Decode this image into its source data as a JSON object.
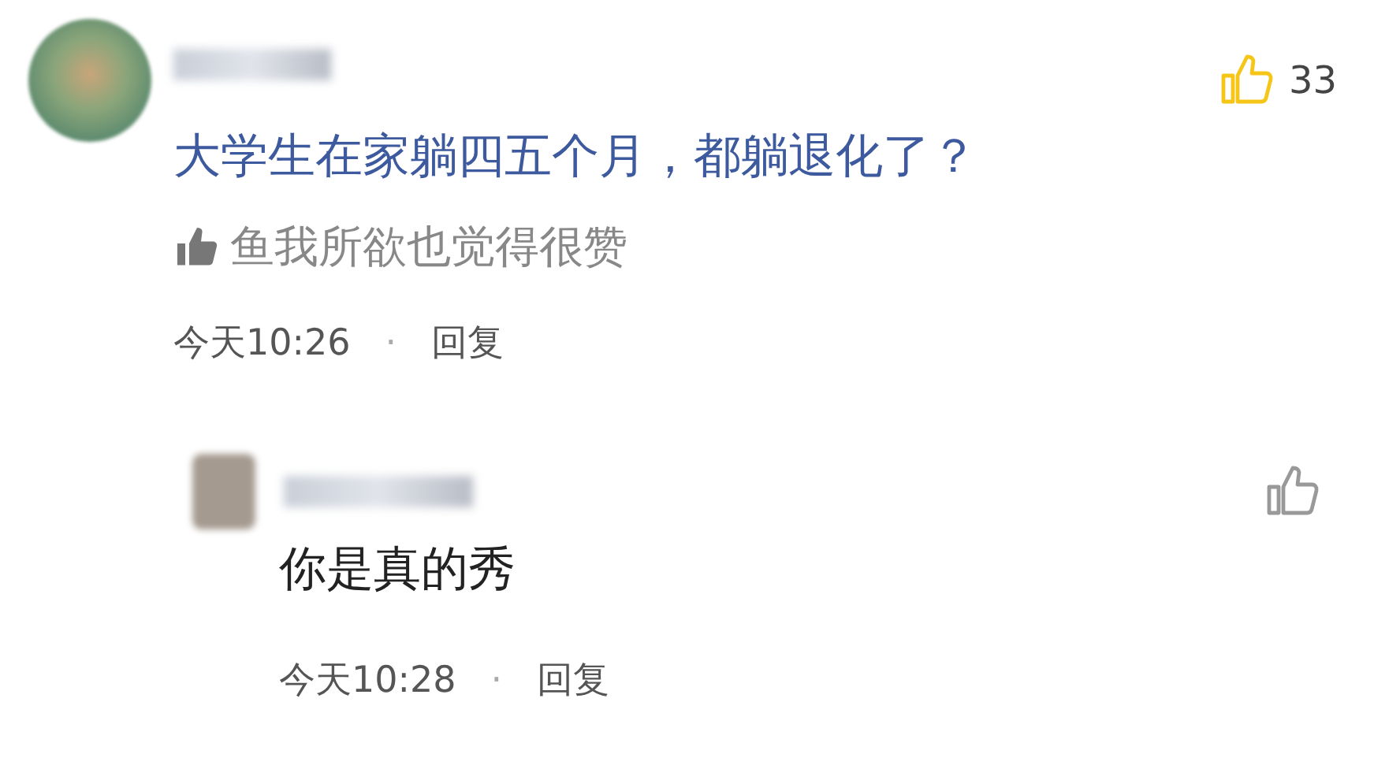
{
  "comments": [
    {
      "kind": "topic",
      "liked": true,
      "likes": "33",
      "text": "大学生在家躺四五个月，都躺退化了？",
      "liked_by": "鱼我所欲也觉得很赞",
      "time": "今天10:26",
      "separator": "·",
      "reply": "回复"
    },
    {
      "kind": "reply",
      "liked": false,
      "text": "你是真的秀",
      "time": "今天10:28",
      "separator": "·",
      "reply": "回复"
    }
  ]
}
